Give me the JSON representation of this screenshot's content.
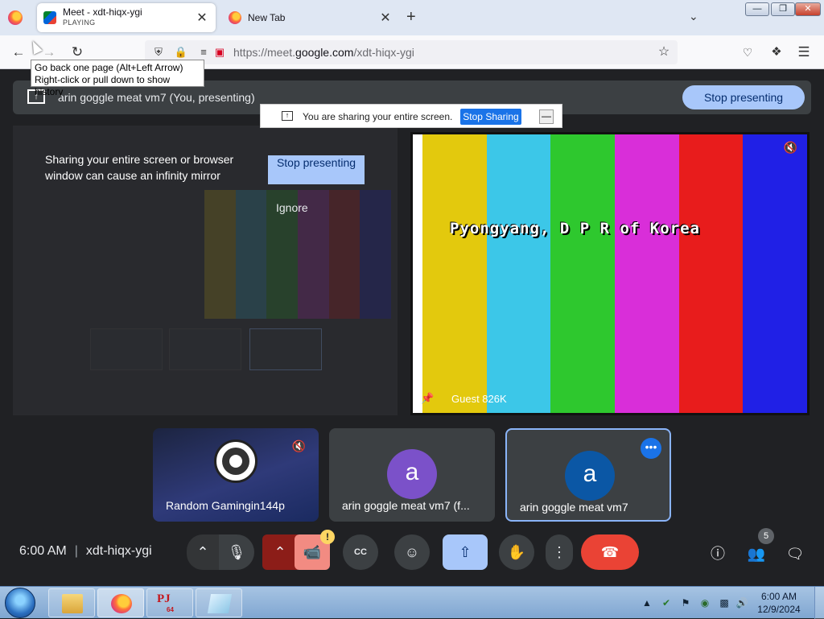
{
  "browser": {
    "tabs": [
      {
        "title": "Meet - xdt-hiqx-ygi",
        "subtitle": "PLAYING",
        "close": "✕"
      },
      {
        "title": "New Tab",
        "close": "✕"
      }
    ],
    "new_tab": "+",
    "tabs_list": "⌄",
    "window_controls": {
      "minimize": "—",
      "restore": "❐",
      "close": "✕"
    },
    "url_prefix": "https://meet.",
    "url_domain": "google.com",
    "url_path": "/xdt-hiqx-ygi",
    "tooltip_line1": "Go back one page (Alt+Left Arrow)",
    "tooltip_line2": "Right-click or pull down to show history"
  },
  "meet": {
    "banner_text": "arin goggle meat vm7 (You, presenting)",
    "stop_presenting": "Stop presenting",
    "share_notice": "You are sharing your entire screen.",
    "stop_sharing": "Stop Sharing",
    "share_min": "—",
    "warning": "Sharing your entire screen or browser window can cause an infinity mirror",
    "warning_stop": "Stop presenting",
    "warning_ignore": "Ignore",
    "guest_overlay": "Pyongyang, D P R of Korea",
    "guest_name": "Guest 826K",
    "participants": [
      {
        "name": "Random Gamingin144p"
      },
      {
        "name": "arin goggle meat vm7 (f...",
        "initial": "a",
        "color": "#7b51c9"
      },
      {
        "name": "arin goggle meat vm7",
        "initial": "a",
        "color": "#0b57a5"
      }
    ],
    "more_options": "•••",
    "clock_time": "6:00 AM",
    "meeting_code": "xdt-hiqx-ygi",
    "people_count": "5",
    "camera_warning": "!",
    "captions_label": "CC"
  },
  "colors": {
    "bars": [
      "#fff",
      "#e3c90d",
      "#3cc7e8",
      "#2ec82e",
      "#d92ed9",
      "#e81c1c",
      "#2020e6"
    ]
  },
  "icons": [
    "firefox-icon",
    "back-icon",
    "forward-icon",
    "reload-icon",
    "shield-icon",
    "lock-icon",
    "permissions-icon",
    "share-indicator-icon",
    "bookmark-star-icon",
    "pocket-icon",
    "extensions-icon",
    "menu-icon",
    "present-icon",
    "mic-icon",
    "camera-off-icon",
    "captions-icon",
    "emoji-icon",
    "hand-icon",
    "more-vert-icon",
    "leave-call-icon",
    "info-icon",
    "people-icon",
    "chat-icon",
    "pin-icon",
    "mic-off-icon"
  ],
  "taskbar": {
    "pj_label": "PJ",
    "pj_sub": "64",
    "time": "6:00 AM",
    "date": "12/9/2024"
  }
}
